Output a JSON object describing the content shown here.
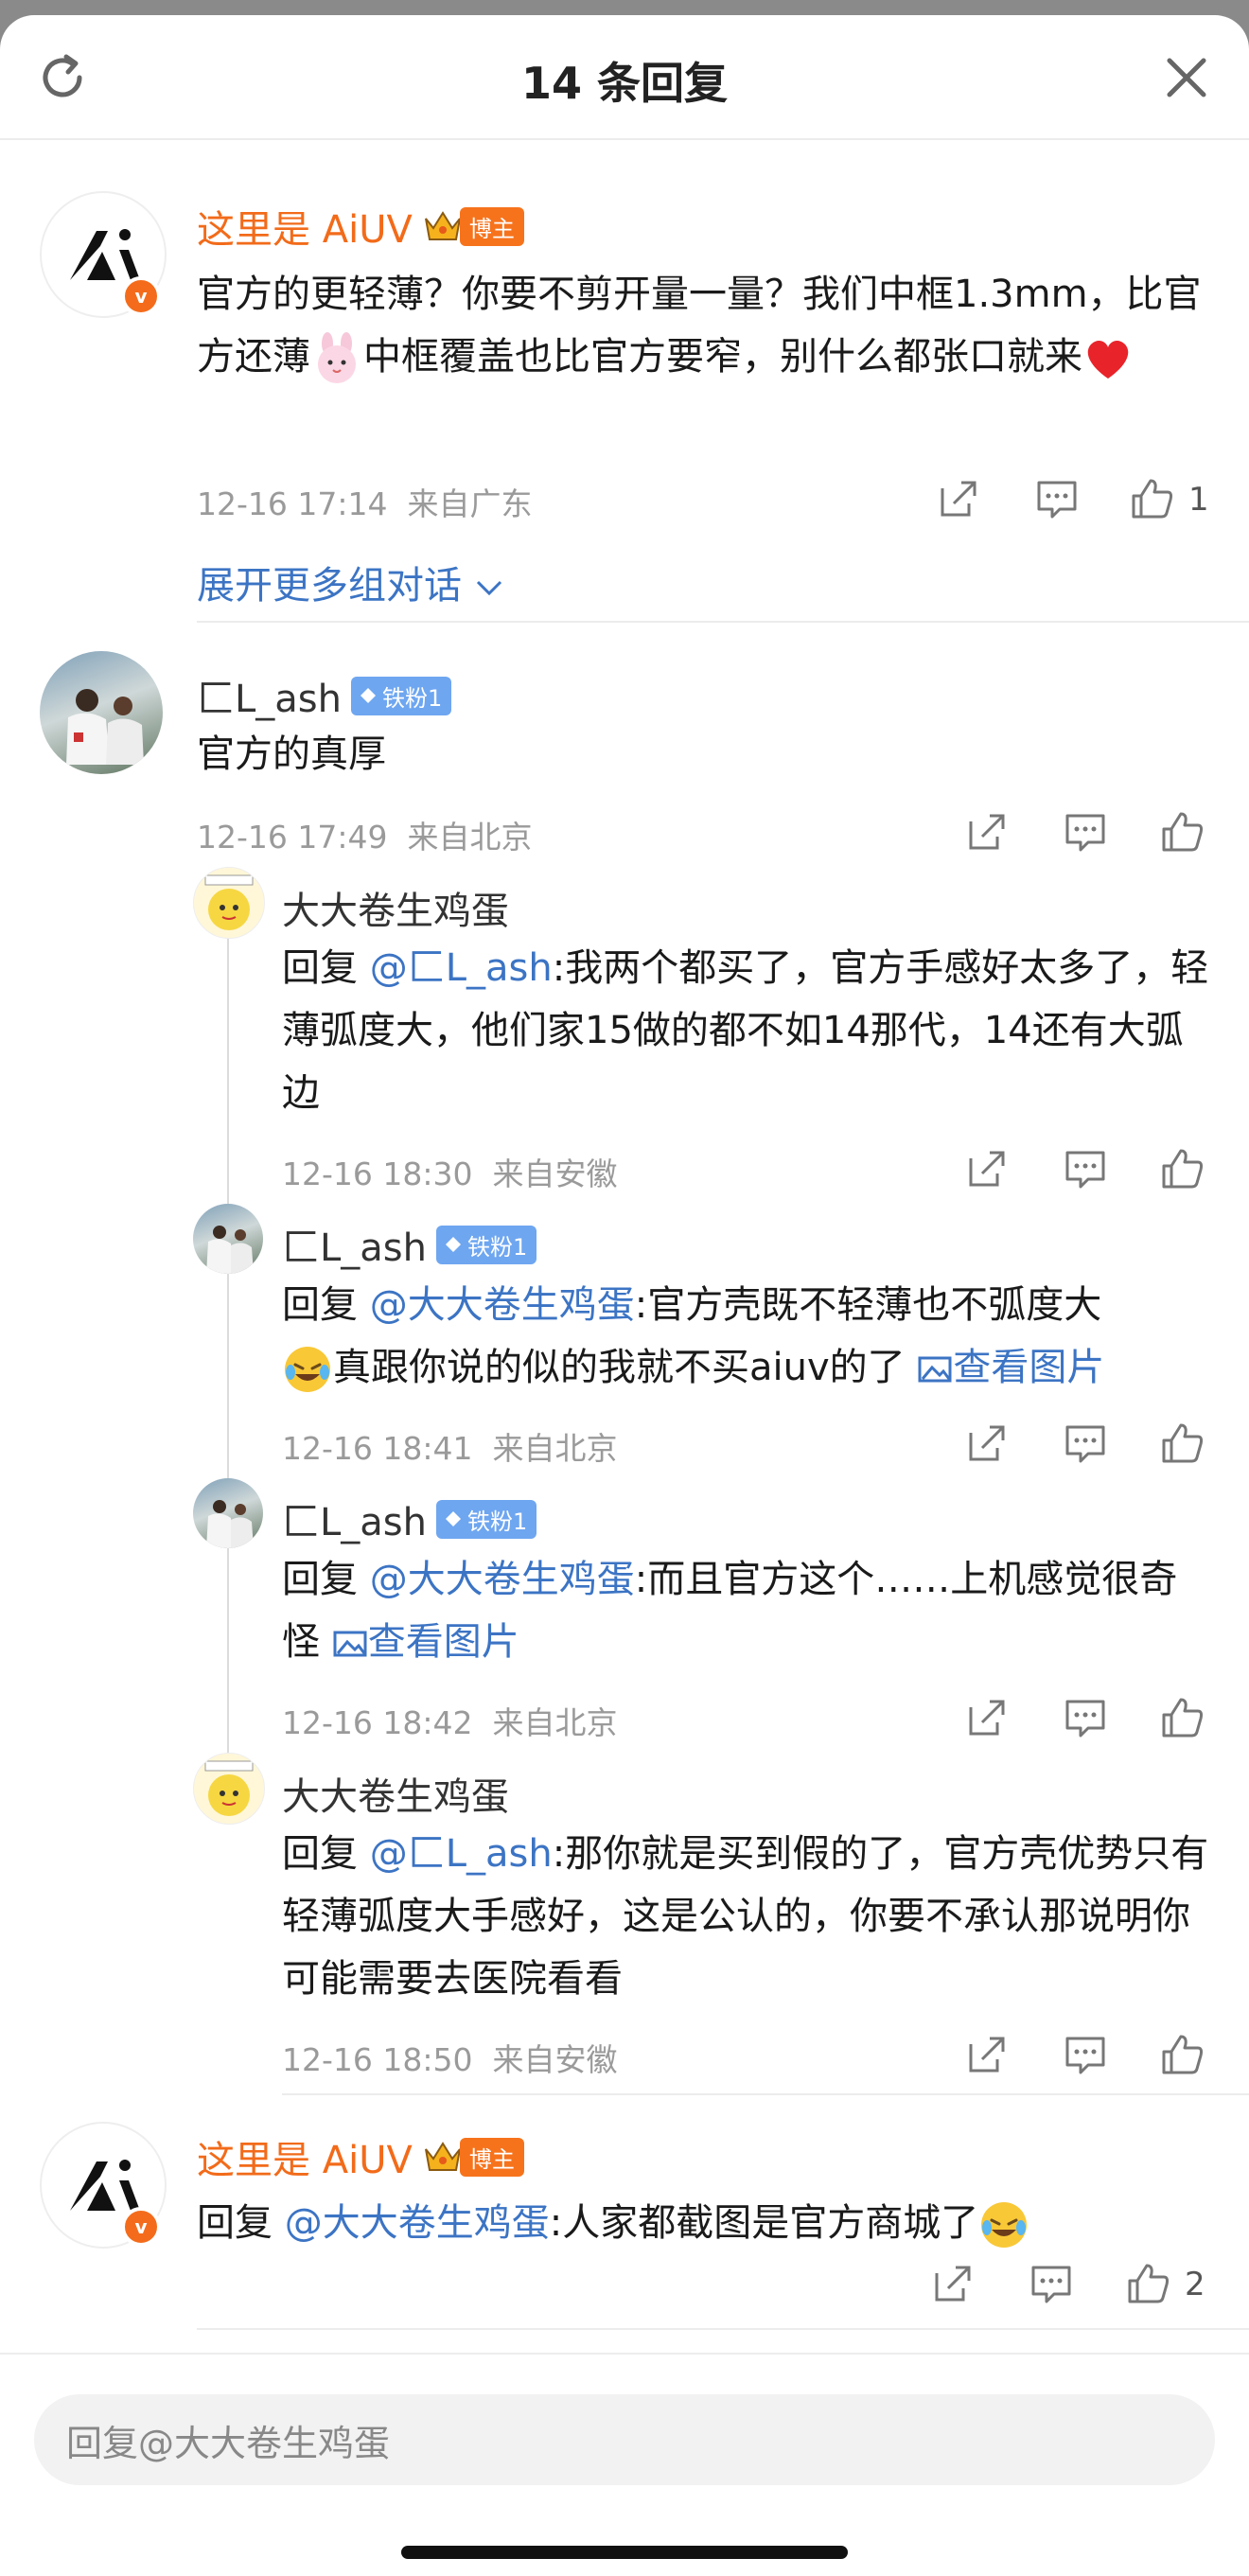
{
  "header": {
    "title": "14 条回复",
    "refresh_icon": "refresh-icon",
    "close_icon": "close-icon"
  },
  "comments": [
    {
      "name": "这里是 AiUV",
      "badge": "博主",
      "text": "官方的更轻薄？你要不剪开量一量？我们中框1.3mm，比官方还薄",
      "text2": "中框覆盖也比官方要窄，别什么都张口就来",
      "time": "12-16 17:14",
      "location": "来自广东",
      "likes": "1",
      "expand": "展开更多组对话"
    },
    {
      "name": "匚L_ash",
      "badge": "铁粉1",
      "text": "官方的真厚",
      "time": "12-16 17:49",
      "location": "来自北京"
    }
  ],
  "replies": [
    {
      "name": "大大卷生鸡蛋",
      "prefix": "回复",
      "mention": "@匚L_ash",
      "text": ":我两个都买了，官方手感好太多了，轻薄弧度大，他们家15做的都不如14那代，14还有大弧边",
      "time": "12-16 18:30",
      "location": "来自安徽"
    },
    {
      "name": "匚L_ash",
      "badge": "铁粉1",
      "prefix": "回复",
      "mention": "@大大卷生鸡蛋",
      "text": ":官方壳既不轻薄也不弧度大",
      "text2": "真跟你说的似的我就不买aiuv的了",
      "link": "查看图片",
      "time": "12-16 18:41",
      "location": "来自北京"
    },
    {
      "name": "匚L_ash",
      "badge": "铁粉1",
      "prefix": "回复",
      "mention": "@大大卷生鸡蛋",
      "text": ":而且官方这个……上机感觉很奇怪",
      "link": "查看图片",
      "time": "12-16 18:42",
      "location": "来自北京"
    },
    {
      "name": "大大卷生鸡蛋",
      "prefix": "回复",
      "mention": "@匚L_ash",
      "text": ":那你就是买到假的了，官方壳优势只有轻薄弧度大手感好，这是公认的，你要不承认那说明你可能需要去医院看看",
      "time": "12-16 18:50",
      "location": "来自安徽"
    }
  ],
  "last": {
    "name": "这里是 AiUV",
    "badge": "博主",
    "prefix": "回复",
    "mention": "@大大卷生鸡蛋",
    "text": ":人家都截图是官方商城了",
    "likes": "2"
  },
  "input": {
    "placeholder": "回复@大大卷生鸡蛋"
  },
  "colors": {
    "blogger_orange": "#f26b1a",
    "link_blue": "#3c74c4",
    "fan_badge": "#6ea6f0"
  }
}
